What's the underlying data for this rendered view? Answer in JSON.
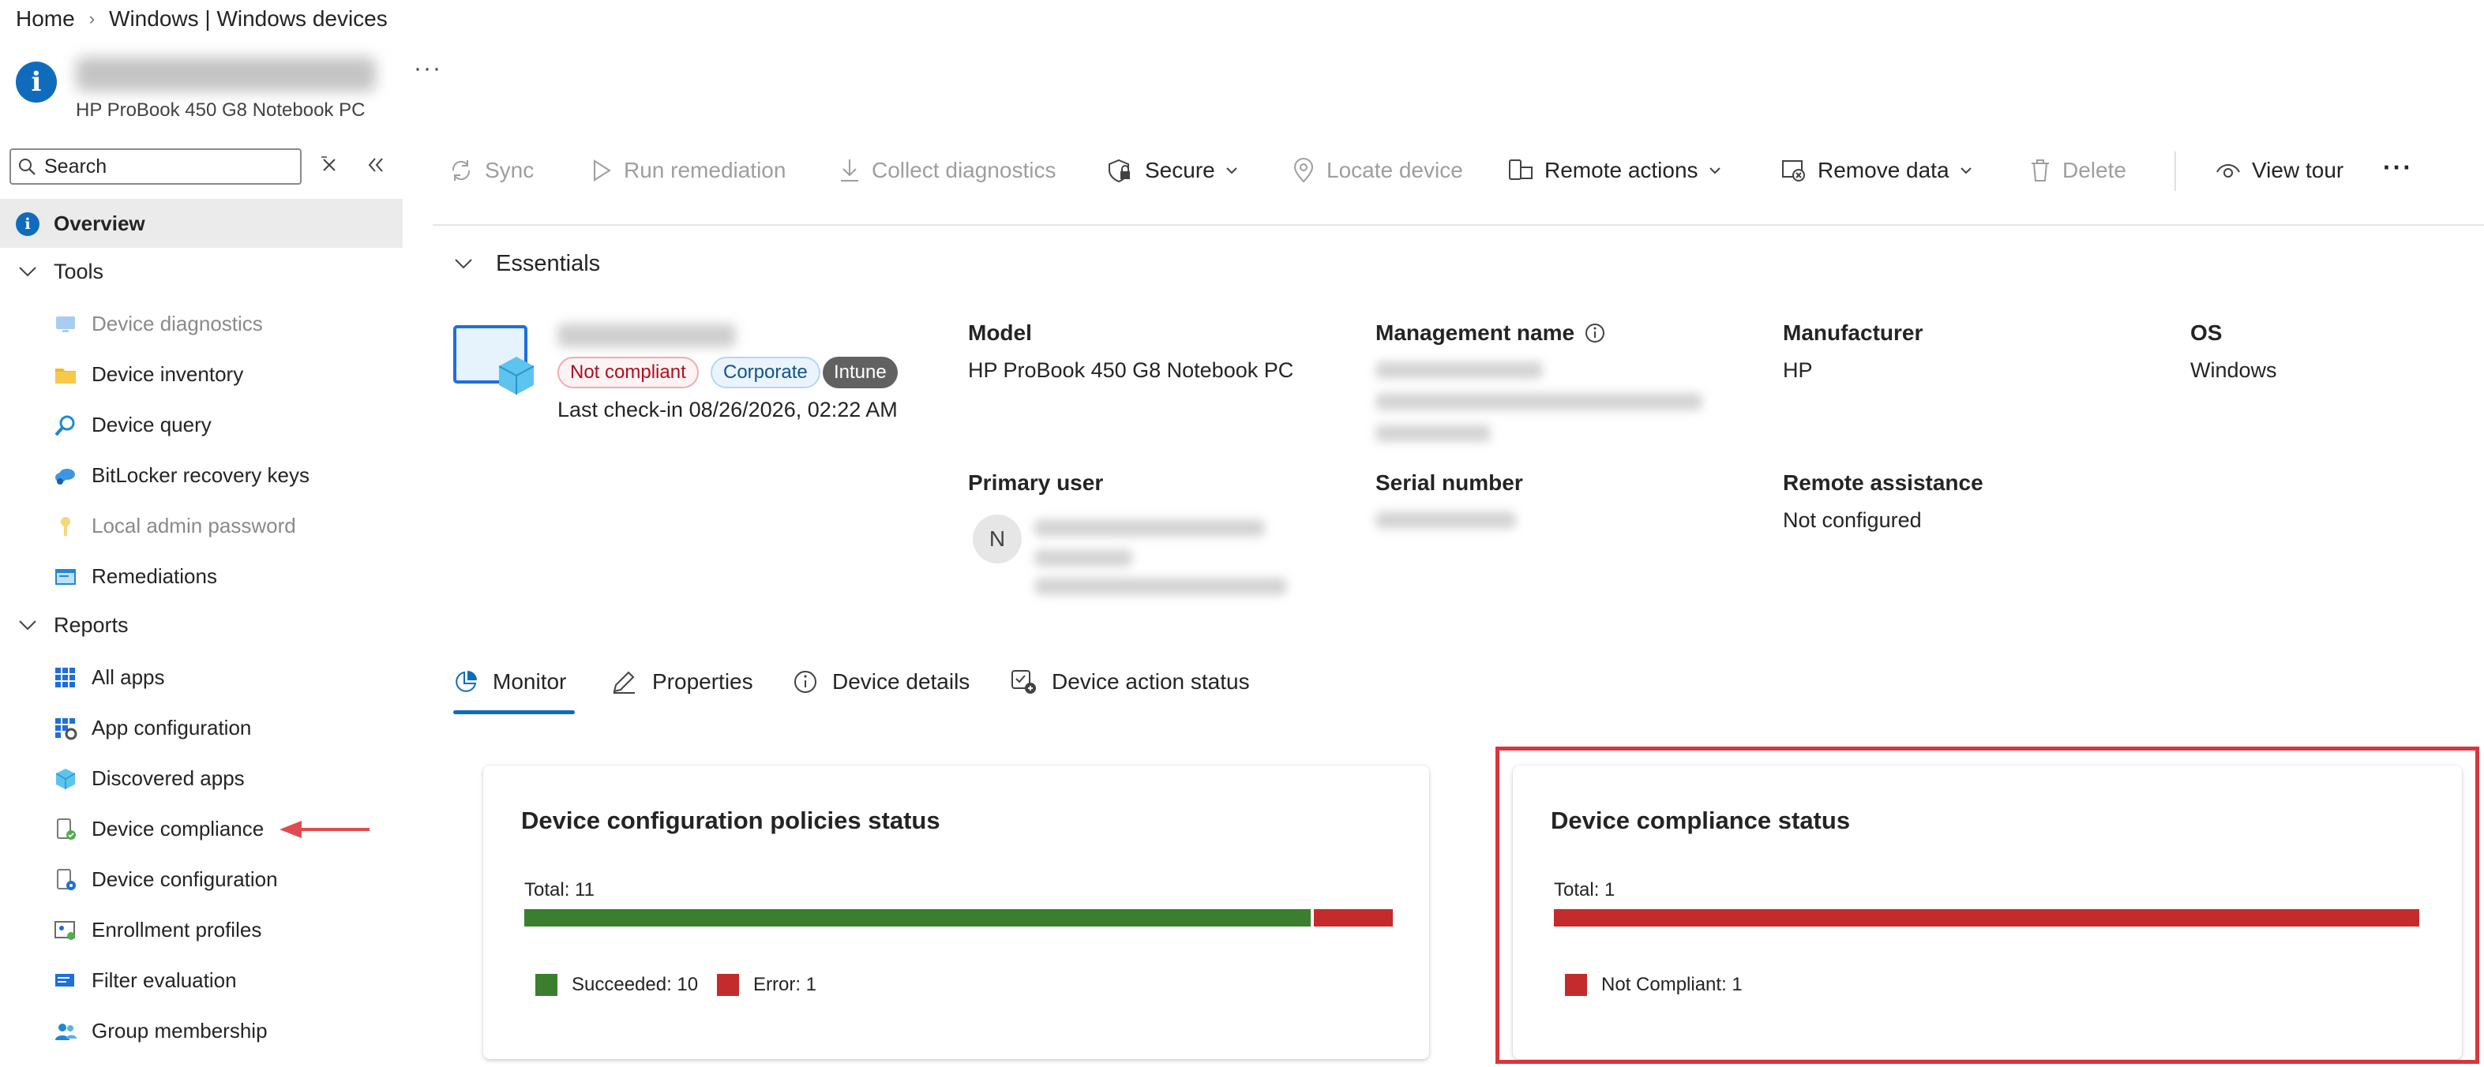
{
  "breadcrumb": {
    "home": "Home",
    "separator": "›",
    "current": "Windows | Windows devices"
  },
  "device": {
    "model_subtitle": "HP ProBook 450 G8 Notebook PC",
    "more_label": "···"
  },
  "sidebar": {
    "search_placeholder": "Search",
    "overview": "Overview",
    "groups": {
      "tools": {
        "label": "Tools",
        "items": [
          "Device diagnostics",
          "Device inventory",
          "Device query",
          "BitLocker recovery keys",
          "Local admin password",
          "Remediations"
        ]
      },
      "reports": {
        "label": "Reports",
        "items": [
          "All apps",
          "App configuration",
          "Discovered apps",
          "Device compliance",
          "Device configuration",
          "Enrollment profiles",
          "Filter evaluation",
          "Group membership"
        ]
      }
    }
  },
  "toolbar": {
    "sync": "Sync",
    "run_remediation": "Run remediation",
    "collect_diagnostics": "Collect diagnostics",
    "secure": "Secure",
    "locate_device": "Locate device",
    "remote_actions": "Remote actions",
    "remove_data": "Remove data",
    "delete": "Delete",
    "view_tour": "View tour",
    "more": "···"
  },
  "essentials": {
    "header": "Essentials",
    "badges": {
      "compliance": "Not compliant",
      "ownership": "Corporate",
      "management": "Intune"
    },
    "last_checkin": "Last check-in 08/26/2026, 02:22 AM",
    "model_label": "Model",
    "model_value": "HP ProBook 450 G8 Notebook PC",
    "management_name_label": "Management name",
    "manufacturer_label": "Manufacturer",
    "manufacturer_value": "HP",
    "os_label": "OS",
    "os_value": "Windows",
    "primary_user_label": "Primary user",
    "primary_user_initial": "N",
    "serial_label": "Serial number",
    "remote_assistance_label": "Remote assistance",
    "remote_assistance_value": "Not configured"
  },
  "tabs": [
    "Monitor",
    "Properties",
    "Device details",
    "Device action status"
  ],
  "cards": {
    "config": {
      "title": "Device configuration policies status",
      "total_label": "Total: 11",
      "legend": [
        {
          "label": "Succeeded: 10"
        },
        {
          "label": "Error: 1"
        }
      ]
    },
    "compliance": {
      "title": "Device compliance status",
      "total_label": "Total: 1",
      "legend": [
        {
          "label": "Not Compliant: 1"
        }
      ]
    }
  },
  "chart_data": [
    {
      "type": "bar",
      "title": "Device configuration policies status",
      "total": 11,
      "series": [
        {
          "name": "Succeeded",
          "values": [
            10
          ]
        },
        {
          "name": "Error",
          "values": [
            1
          ]
        }
      ],
      "stacked": true,
      "colors": [
        "#3a7f2e",
        "#c42b2b"
      ]
    },
    {
      "type": "bar",
      "title": "Device compliance status",
      "total": 1,
      "series": [
        {
          "name": "Not Compliant",
          "values": [
            1
          ]
        }
      ],
      "stacked": true,
      "colors": [
        "#c42b2b"
      ]
    }
  ],
  "colors": {
    "accent": "#0f6cbd",
    "success": "#3a7f2e",
    "error": "#c42b2b",
    "highlight": "#d9353d"
  }
}
